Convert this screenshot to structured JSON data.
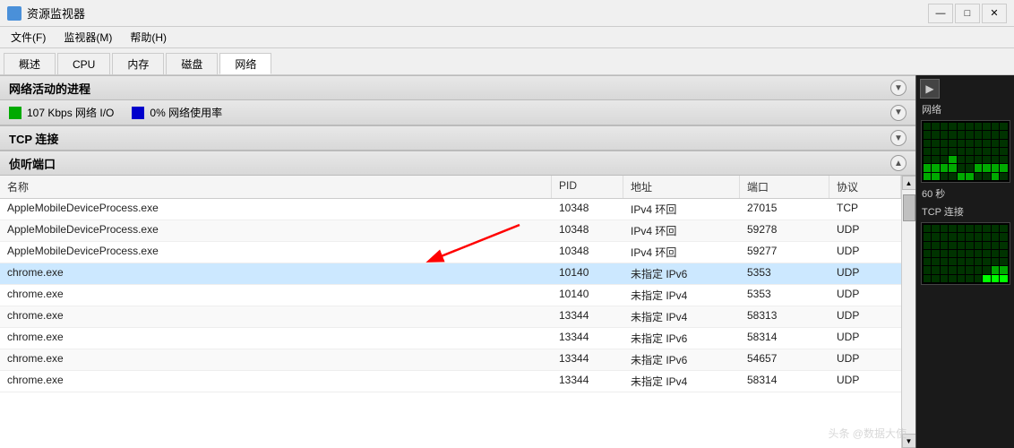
{
  "titleBar": {
    "icon": "monitor-icon",
    "title": "资源监视器",
    "minimizeLabel": "—",
    "maximizeLabel": "□",
    "closeLabel": "✕"
  },
  "menuBar": {
    "items": [
      {
        "label": "文件(F)",
        "id": "file"
      },
      {
        "label": "监视器(M)",
        "id": "monitor"
      },
      {
        "label": "帮助(H)",
        "id": "help"
      }
    ]
  },
  "tabs": [
    {
      "label": "概述",
      "id": "overview",
      "active": false
    },
    {
      "label": "CPU",
      "id": "cpu",
      "active": false
    },
    {
      "label": "内存",
      "id": "memory",
      "active": false
    },
    {
      "label": "磁盘",
      "id": "disk",
      "active": false
    },
    {
      "label": "网络",
      "id": "network",
      "active": true
    }
  ],
  "sections": {
    "networkProcesses": {
      "title": "网络活动的进程",
      "collapsed": false,
      "chevron": "▼"
    },
    "networkActivity": {
      "stat1": {
        "color": "#00aa00",
        "text": "107 Kbps 网络 I/O"
      },
      "stat2": {
        "color": "#0000dd",
        "text": "0% 网络使用率"
      },
      "chevron": "▼"
    },
    "tcpConnections": {
      "title": "TCP 连接",
      "collapsed": true,
      "chevron": "▼"
    },
    "listenPorts": {
      "title": "侦听端口",
      "collapsed": false,
      "chevron": "▲"
    }
  },
  "table": {
    "columns": [
      {
        "id": "name",
        "label": "名称"
      },
      {
        "id": "pid",
        "label": "PID"
      },
      {
        "id": "address",
        "label": "地址"
      },
      {
        "id": "port",
        "label": "端口"
      },
      {
        "id": "protocol",
        "label": "协议"
      }
    ],
    "rows": [
      {
        "name": "AppleMobileDeviceProcess.exe",
        "pid": "10348",
        "address": "IPv4 环回",
        "port": "27015",
        "protocol": "TCP",
        "highlighted": false
      },
      {
        "name": "AppleMobileDeviceProcess.exe",
        "pid": "10348",
        "address": "IPv4 环回",
        "port": "59278",
        "protocol": "UDP",
        "highlighted": false
      },
      {
        "name": "AppleMobileDeviceProcess.exe",
        "pid": "10348",
        "address": "IPv4 环回",
        "port": "59277",
        "protocol": "UDP",
        "highlighted": false
      },
      {
        "name": "chrome.exe",
        "pid": "10140",
        "address": "未指定 IPv6",
        "port": "5353",
        "protocol": "UDP",
        "highlighted": true
      },
      {
        "name": "chrome.exe",
        "pid": "10140",
        "address": "未指定 IPv4",
        "port": "5353",
        "protocol": "UDP",
        "highlighted": false
      },
      {
        "name": "chrome.exe",
        "pid": "13344",
        "address": "未指定 IPv4",
        "port": "58313",
        "protocol": "UDP",
        "highlighted": false
      },
      {
        "name": "chrome.exe",
        "pid": "13344",
        "address": "未指定 IPv6",
        "port": "58314",
        "protocol": "UDP",
        "highlighted": false
      },
      {
        "name": "chrome.exe",
        "pid": "13344",
        "address": "未指定 IPv6",
        "port": "54657",
        "protocol": "UDP",
        "highlighted": false
      },
      {
        "name": "chrome.exe",
        "pid": "13344",
        "address": "未指定 IPv4",
        "port": "58314",
        "protocol": "UDP",
        "highlighted": false
      }
    ]
  },
  "rightPanel": {
    "expandLabel": "▶",
    "graphLabel1": "网络",
    "graphLabel2": "60 秒",
    "graphLabel3": "TCP 连接"
  },
  "watermark": "头条 @数据大使"
}
